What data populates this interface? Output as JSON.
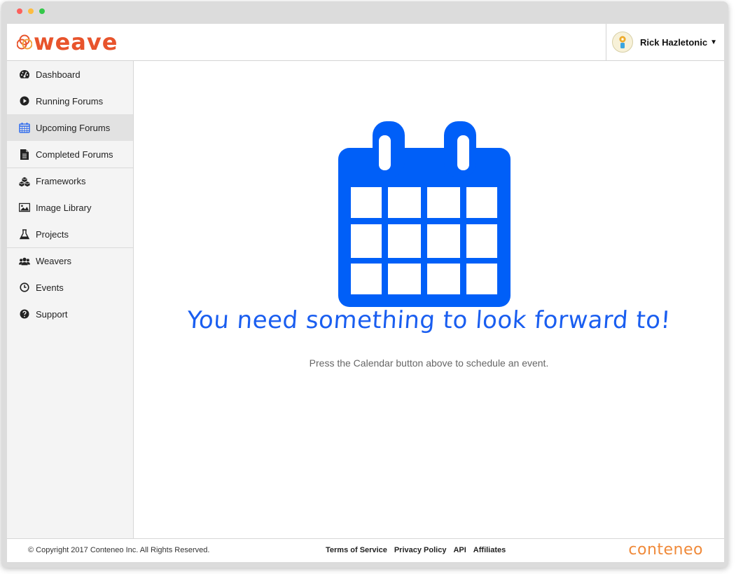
{
  "window": {
    "traffic_lights": [
      "#fc605c",
      "#fdbc40",
      "#34c84a"
    ]
  },
  "header": {
    "logo_text": "weave",
    "logo_color": "#e8542c",
    "user_name": "Rick Hazletonic",
    "user_menu_caret": "▼"
  },
  "sidebar": {
    "items": [
      {
        "label": "Dashboard",
        "icon": "dashboard-icon"
      },
      {
        "label": "Running Forums",
        "icon": "play-circle-icon"
      },
      {
        "label": "Upcoming Forums",
        "icon": "calendar-icon",
        "active": true
      },
      {
        "label": "Completed Forums",
        "icon": "document-icon"
      },
      {
        "label": "Frameworks",
        "icon": "cubes-icon"
      },
      {
        "label": "Image Library",
        "icon": "image-icon"
      },
      {
        "label": "Projects",
        "icon": "flask-icon"
      },
      {
        "label": "Weavers",
        "icon": "users-icon"
      },
      {
        "label": "Events",
        "icon": "clock-icon"
      },
      {
        "label": "Support",
        "icon": "question-circle-icon"
      }
    ]
  },
  "main": {
    "illustration_icon": "calendar-icon",
    "illustration_color": "#005ff8",
    "headline": "You need something to look forward to!",
    "subtext": "Press the Calendar button above to schedule an event."
  },
  "footer": {
    "copyright": "© Copyright 2017 Conteneo Inc. All Rights Reserved.",
    "links": [
      "Terms of Service",
      "Privacy Policy",
      "API",
      "Affiliates"
    ],
    "brand": "conteneo",
    "brand_color": "#f08a3a"
  }
}
